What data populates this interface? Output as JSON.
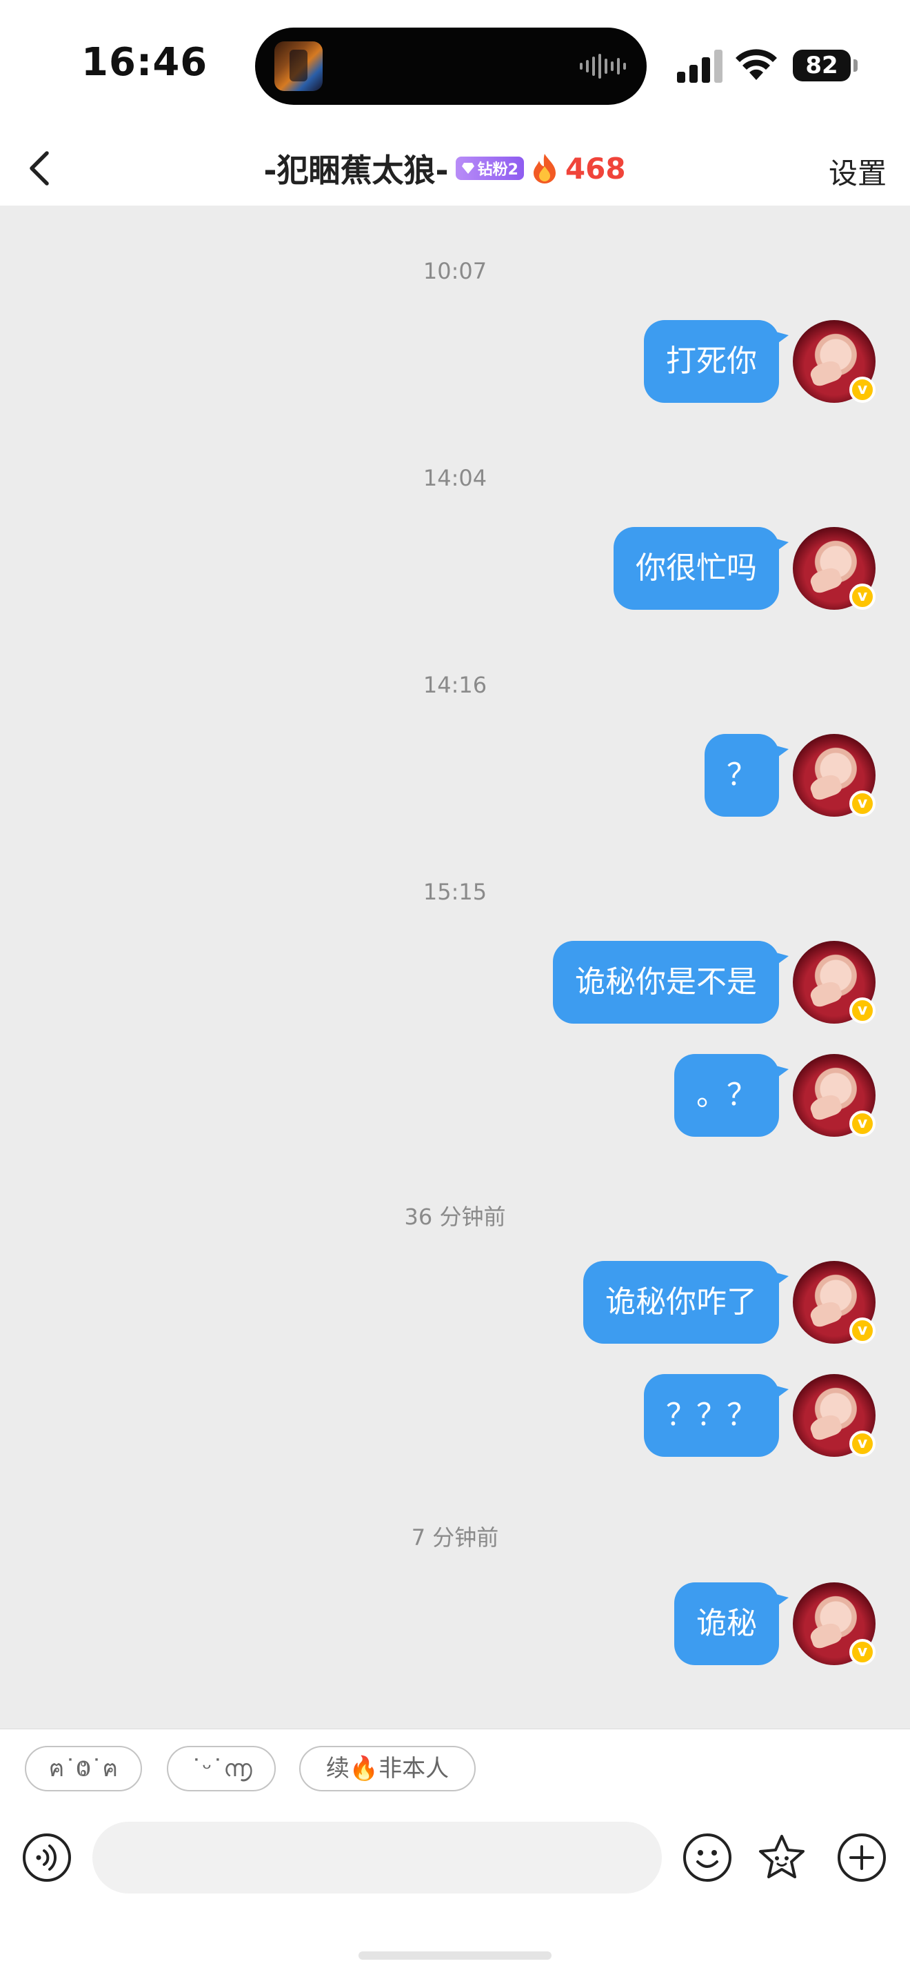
{
  "status_bar": {
    "time": "16:46",
    "battery": "82"
  },
  "nav": {
    "title": "-犯睏蕉太狼-",
    "badge_label": "钻粉2",
    "fire_count": "468",
    "settings_label": "设置"
  },
  "messages": [
    {
      "time": "10:07",
      "text": "打死你"
    },
    {
      "time": "14:04",
      "text": "你很忙吗"
    },
    {
      "time": "14:16",
      "text": "？"
    },
    {
      "time": "15:15",
      "text": "诡秘你是不是"
    },
    {
      "text": "。？"
    },
    {
      "time": "36 分钟前",
      "text": "诡秘你咋了"
    },
    {
      "text": "？？？"
    },
    {
      "time": "7 分钟前",
      "text": "诡秘"
    }
  ],
  "quick_replies": [
    "ฅ˙Ⱉ˙ฅ",
    "˙ᵕ˙൬",
    "续🔥非本人"
  ],
  "input": {
    "placeholder": "",
    "value": ""
  },
  "colors": {
    "bubble": "#3d9cf0",
    "fire": "#f0443a",
    "badge": "#9b6cf3"
  }
}
